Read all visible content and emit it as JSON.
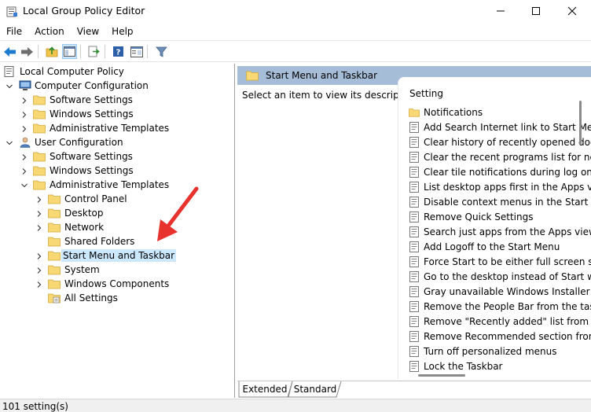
{
  "window": {
    "title": "Local Group Policy Editor"
  },
  "menu": [
    "File",
    "Action",
    "View",
    "Help"
  ],
  "tree": {
    "root": "Local Computer Policy",
    "computer_config": "Computer Configuration",
    "cc_children": [
      "Software Settings",
      "Windows Settings",
      "Administrative Templates"
    ],
    "user_config": "User Configuration",
    "uc_children": [
      "Software Settings",
      "Windows Settings",
      "Administrative Templates"
    ],
    "admin_children": [
      "Control Panel",
      "Desktop",
      "Network",
      "Shared Folders",
      "Start Menu and Taskbar",
      "System",
      "Windows Components",
      "All Settings"
    ],
    "selected": "Start Menu and Taskbar"
  },
  "right": {
    "header": "Start Menu and Taskbar",
    "description": "Select an item to view its description.",
    "column": "Setting",
    "items": [
      {
        "label": "Notifications",
        "type": "folder"
      },
      {
        "label": "Add Search Internet link to Start Menu",
        "type": "policy"
      },
      {
        "label": "Clear history of recently opened documents",
        "type": "policy"
      },
      {
        "label": "Clear the recent programs list for new users",
        "type": "policy"
      },
      {
        "label": "Clear tile notifications during log on",
        "type": "policy"
      },
      {
        "label": "List desktop apps first in the Apps view",
        "type": "policy"
      },
      {
        "label": "Disable context menus in the Start Menu",
        "type": "policy"
      },
      {
        "label": "Remove Quick Settings",
        "type": "policy"
      },
      {
        "label": "Search just apps from the Apps view",
        "type": "policy"
      },
      {
        "label": "Add Logoff to the Start Menu",
        "type": "policy"
      },
      {
        "label": "Force Start to be either full screen size or menu size",
        "type": "policy"
      },
      {
        "label": "Go to the desktop instead of Start when signing in",
        "type": "policy"
      },
      {
        "label": "Gray unavailable Windows Installer programs",
        "type": "policy"
      },
      {
        "label": "Remove the People Bar from the taskbar",
        "type": "policy"
      },
      {
        "label": "Remove \"Recently added\" list from Start Menu",
        "type": "policy"
      },
      {
        "label": "Remove Recommended section from Start Menu",
        "type": "policy"
      },
      {
        "label": "Turn off personalized menus",
        "type": "policy"
      },
      {
        "label": "Lock the Taskbar",
        "type": "policy"
      }
    ]
  },
  "tabs": [
    "Extended",
    "Standard"
  ],
  "status": {
    "text": "101 setting(s)"
  },
  "colors": {
    "accent": "#cce8ff",
    "header": "#a6bdd7",
    "arrow": "#e8322e"
  }
}
